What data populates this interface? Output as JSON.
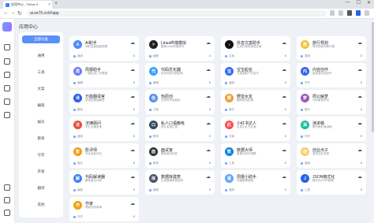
{
  "browser": {
    "tab_title": "应用中心 - Thrive X",
    "new_tab": "+",
    "url": "ai.se75.cn/#/app",
    "win_min": "—",
    "win_max": "☐",
    "win_close": "✕"
  },
  "page": {
    "title": "应用中心"
  },
  "categories": [
    {
      "label": "全部分类",
      "active": true
    },
    {
      "label": "通用"
    },
    {
      "label": "工具"
    },
    {
      "label": "文案"
    },
    {
      "label": "编程"
    },
    {
      "label": "娱乐"
    },
    {
      "label": "教育"
    },
    {
      "label": "写作"
    },
    {
      "label": "开发"
    },
    {
      "label": "翻译"
    },
    {
      "label": "其他"
    }
  ],
  "cards": [
    {
      "name": "AI助手",
      "desc": "你的全能智能助理",
      "footer": "通用",
      "stat": "4",
      "icon_letter": "A",
      "color": "#4f8cff"
    },
    {
      "name": "Linux终端模拟",
      "desc": "模拟Linux终端命令",
      "footer": "编程",
      "stat": "4",
      "icon_letter": ">",
      "color": "#222222"
    },
    {
      "name": "抖音文案助手",
      "desc": "生成抖音短视频文案",
      "footer": "文案",
      "stat": "0",
      "icon_letter": "♪",
      "color": "#111111"
    },
    {
      "name": "旅行规划",
      "desc": "帮你规划完美行程",
      "footer": "通用",
      "stat": "0",
      "icon_letter": "旅",
      "color": "#f3c23d"
    },
    {
      "name": "周报助手",
      "desc": "一键生成工作周报",
      "footer": "编辑",
      "stat": "0",
      "icon_letter": "周",
      "color": "#6b7cff"
    },
    {
      "name": "代码优化器",
      "desc": "优化你的代码结构",
      "footer": "编程",
      "stat": "0",
      "icon_letter": "代",
      "color": "#3aa0ff"
    },
    {
      "name": "宝宝起名",
      "desc": "为宝宝取个好名字",
      "footer": "通用",
      "stat": "0",
      "icon_letter": "宝",
      "color": "#2f6bff"
    },
    {
      "name": "内容创作",
      "desc": "高质量内容创作",
      "footer": "写作",
      "stat": "0",
      "icon_letter": "内",
      "color": "#3563e9"
    },
    {
      "name": "万能翻译官",
      "desc": "多语言精准翻译",
      "footer": "翻译",
      "stat": "0",
      "icon_letter": "译",
      "color": "#2b5ce6"
    },
    {
      "name": "伪原创",
      "desc": "文章改写伪原创",
      "footer": "文案",
      "stat": "0",
      "icon_letter": "伪",
      "color": "#5a8dee"
    },
    {
      "name": "野蛮女友",
      "desc": "趣味角色扮演",
      "footer": "娱乐",
      "stat": "0",
      "icon_letter": "野",
      "color": "#e9a23b"
    },
    {
      "name": "周公解梦",
      "desc": "为你解读梦境",
      "footer": "娱乐",
      "stat": "0",
      "icon_letter": "梦",
      "color": "#9b59b6"
    },
    {
      "name": "法律顾问",
      "desc": "专业法律咨询",
      "footer": "通用",
      "stat": "0",
      "icon_letter": "法",
      "color": "#e74c3c"
    },
    {
      "name": "私人口语教练",
      "desc": "提升英语口语",
      "footer": "教育",
      "stat": "0",
      "icon_letter": "口",
      "color": "#34495e"
    },
    {
      "name": "小红书达人",
      "desc": "生成小红书文案",
      "footer": "文案",
      "stat": "0",
      "icon_letter": "红",
      "color": "#ff4d4f"
    },
    {
      "name": "演讲稿",
      "desc": "撰写精彩演讲稿",
      "footer": "写作",
      "stat": "0",
      "icon_letter": "演",
      "color": "#1abc9c"
    },
    {
      "name": "影评师",
      "desc": "专业电影评论",
      "footer": "娱乐",
      "stat": "0",
      "icon_letter": "影",
      "color": "#f39c12"
    },
    {
      "name": "面试官",
      "desc": "模拟面试问答",
      "footer": "教育",
      "stat": "0",
      "icon_letter": "面",
      "color": "#2d3436"
    },
    {
      "name": "数据大师",
      "desc": "数据分析与洞察",
      "footer": "工具",
      "stat": "0",
      "icon_letter": "数",
      "color": "#0984e3"
    },
    {
      "name": "创业点子",
      "desc": "激发创业灵感",
      "footer": "通用",
      "stat": "0",
      "icon_letter": "创",
      "color": "#fdcb6e"
    },
    {
      "name": "代码解读器",
      "desc": "解读复杂代码",
      "footer": "编程",
      "stat": "0",
      "icon_letter": "解",
      "color": "#3b82f6"
    },
    {
      "name": "数据库建表",
      "desc": "生成数据库表结构",
      "footer": "编程",
      "stat": "0",
      "icon_letter": "库",
      "color": "#4b5563"
    },
    {
      "name": "周报小助手",
      "desc": "快速整理周报",
      "footer": "通用",
      "stat": "0",
      "icon_letter": "报",
      "color": "#60a5fa"
    },
    {
      "name": "JSON格式化",
      "desc": "格式化JSON数据",
      "footer": "工具",
      "stat": "0",
      "icon_letter": "J",
      "color": "#2563eb"
    },
    {
      "name": "作家",
      "desc": "帮你创作故事",
      "footer": "写作",
      "stat": "0",
      "icon_letter": "作",
      "color": "#f59e0b"
    }
  ]
}
